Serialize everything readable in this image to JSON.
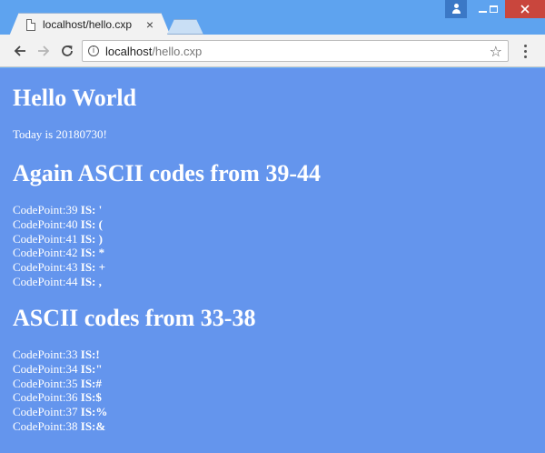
{
  "browser": {
    "tab_title": "localhost/hello.cxp",
    "tab_close": "×",
    "url_host": "localhost",
    "url_path": "/hello.cxp"
  },
  "page": {
    "heading1": "Hello World",
    "today_text": "Today is 20180730!",
    "heading2": "Again ASCII codes from 39-44",
    "list1": [
      {
        "label": "CodePoint:39",
        "is": "IS:",
        "value": "'"
      },
      {
        "label": "CodePoint:40",
        "is": "IS:",
        "value": "("
      },
      {
        "label": "CodePoint:41",
        "is": "IS:",
        "value": ")"
      },
      {
        "label": "CodePoint:42",
        "is": "IS:",
        "value": "*"
      },
      {
        "label": "CodePoint:43",
        "is": "IS:",
        "value": "+"
      },
      {
        "label": "CodePoint:44",
        "is": "IS:",
        "value": ","
      }
    ],
    "heading3": "ASCII codes from 33-38",
    "list2": [
      {
        "label": "CodePoint:33",
        "is": "IS:",
        "value": "!"
      },
      {
        "label": "CodePoint:34",
        "is": "IS:",
        "value": "\""
      },
      {
        "label": "CodePoint:35",
        "is": "IS:",
        "value": "#"
      },
      {
        "label": "CodePoint:36",
        "is": "IS:",
        "value": "$"
      },
      {
        "label": "CodePoint:37",
        "is": "IS:",
        "value": "%"
      },
      {
        "label": "CodePoint:38",
        "is": "IS:",
        "value": "&"
      }
    ]
  },
  "colors": {
    "page_background": "#6495ed",
    "titlebar": "#5ea3ef",
    "close_button": "#c9463d"
  }
}
